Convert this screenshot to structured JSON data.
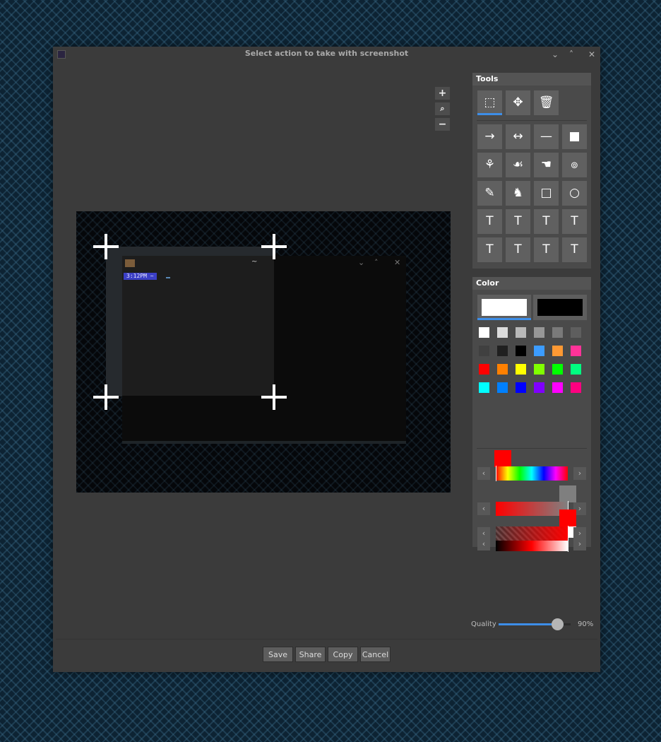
{
  "window": {
    "title": "Select action to take with screenshot"
  },
  "terminal": {
    "title": "~",
    "prompt": "3:12PM ~ ",
    "minimize": "⌄",
    "maximize": "˄",
    "close": "✕"
  },
  "zoom": {
    "in": "+",
    "fit": "⌕",
    "out": "−"
  },
  "tools": {
    "header": "Tools",
    "items": [
      {
        "name": "crop-tool",
        "glyph": "⬚",
        "active": true
      },
      {
        "name": "move-tool",
        "glyph": "✥"
      },
      {
        "name": "delete-tool",
        "glyph": "🗑"
      },
      {
        "name": "arrow-tool",
        "glyph": "→"
      },
      {
        "name": "double-arrow-tool",
        "glyph": "↔"
      },
      {
        "name": "line-tool",
        "glyph": "—"
      },
      {
        "name": "filled-rectangle-tool",
        "glyph": "■"
      },
      {
        "name": "sticker-animal-tool",
        "glyph": "⚘"
      },
      {
        "name": "sticker-figure-tool",
        "glyph": "☙"
      },
      {
        "name": "pointing-hand-tool",
        "glyph": "☚"
      },
      {
        "name": "spiral-tool",
        "glyph": "๏"
      },
      {
        "name": "pencil-tool",
        "glyph": "✎"
      },
      {
        "name": "stamp-tool",
        "glyph": "♞"
      },
      {
        "name": "rectangle-tool",
        "glyph": "□"
      },
      {
        "name": "ellipse-tool",
        "glyph": "○"
      },
      {
        "name": "text-frame-tool",
        "glyph": "T"
      },
      {
        "name": "text-box-tool",
        "glyph": "T"
      },
      {
        "name": "cloud-text-tool",
        "glyph": "T"
      },
      {
        "name": "cloud-text-alt-tool",
        "glyph": "T"
      },
      {
        "name": "speech-bubble-tool",
        "glyph": "T"
      },
      {
        "name": "speech-bubble-alt-tool",
        "glyph": "T"
      },
      {
        "name": "explosion-text-tool",
        "glyph": "T"
      },
      {
        "name": "explosion-text-alt-tool",
        "glyph": "T"
      }
    ]
  },
  "color": {
    "header": "Color",
    "primary": "#ffffff",
    "secondary": "#000000",
    "palette": [
      "#ffffff",
      "#dcdcdc",
      "#b9b9b9",
      "#979797",
      "#7a7a7a",
      "#5e5e5e",
      "#404040",
      "#202020",
      "#000000",
      "#3c9cff",
      "#ff9933",
      "#ff3399",
      "#ff0000",
      "#ff8000",
      "#ffff00",
      "#80ff00",
      "#00ff00",
      "#00ff80",
      "#00ffff",
      "#0080ff",
      "#0000ff",
      "#8000ff",
      "#ff00ff",
      "#ff0080"
    ],
    "hue": 0.0,
    "saturation": 1.0,
    "lightness": 1.0,
    "alpha": 1.0,
    "arrow_left": "‹",
    "arrow_right": "›"
  },
  "quality": {
    "label": "Quality",
    "value": 90,
    "display": "90%"
  },
  "actions": {
    "save": "Save",
    "share": "Share",
    "copy": "Copy",
    "cancel": "Cancel"
  }
}
